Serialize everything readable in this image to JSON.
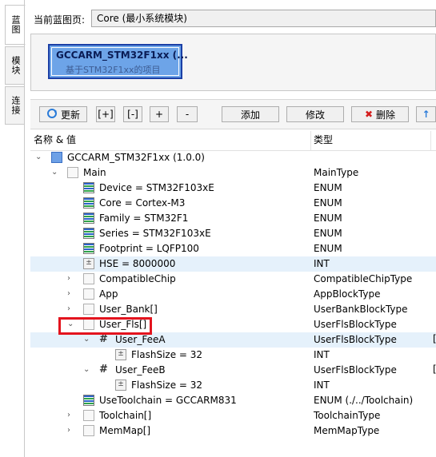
{
  "side_tabs": [
    "蓝图",
    "模块",
    "连接"
  ],
  "top": {
    "current_label": "当前蓝图页:",
    "current_value": "Core (最小系统模块)"
  },
  "module": {
    "title": "GCCARM_STM32F1xx (...",
    "subtitle": "基于STM32F1xx的项目"
  },
  "toolbar": {
    "refresh": "更新",
    "expand": "[+]",
    "collapse": "[-]",
    "plus": "+",
    "minus": "-",
    "add": "添加",
    "edit": "修改",
    "delete": "删除",
    "up": "↑"
  },
  "tree": {
    "col_name": "名称 & 值",
    "col_type": "类型",
    "rows": [
      {
        "text": "GCCARM_STM32F1xx (1.0.0)",
        "type": ""
      },
      {
        "text": "Main",
        "type": "MainType"
      },
      {
        "text": "Device = STM32F103xE",
        "type": "ENUM"
      },
      {
        "text": "Core = Cortex-M3",
        "type": "ENUM"
      },
      {
        "text": "Family = STM32F1",
        "type": "ENUM"
      },
      {
        "text": "Series = STM32F103xE",
        "type": "ENUM"
      },
      {
        "text": "Footprint = LQFP100",
        "type": "ENUM"
      },
      {
        "text": "HSE = 8000000",
        "type": "INT"
      },
      {
        "text": "CompatibleChip",
        "type": "CompatibleChipType"
      },
      {
        "text": "App",
        "type": "AppBlockType"
      },
      {
        "text": "User_Bank[]",
        "type": "UserBankBlockType"
      },
      {
        "text": "User_Fls[]",
        "type": "UserFlsBlockType"
      },
      {
        "text": "User_FeeA",
        "type": "UserFlsBlockType",
        "extra": "["
      },
      {
        "text": "FlashSize = 32",
        "type": "INT"
      },
      {
        "text": "User_FeeB",
        "type": "UserFlsBlockType",
        "extra": "["
      },
      {
        "text": "FlashSize = 32",
        "type": "INT"
      },
      {
        "text": "UseToolchain = GCCARM831",
        "type": "ENUM (./../Toolchain)"
      },
      {
        "text": "Toolchain[]",
        "type": "ToolchainType"
      },
      {
        "text": "MemMap[]",
        "type": "MemMapType"
      }
    ]
  },
  "colors": {
    "selected_row": "#e5f1fb",
    "module_fill": "#6da4e8",
    "highlight": "#e3141e"
  }
}
